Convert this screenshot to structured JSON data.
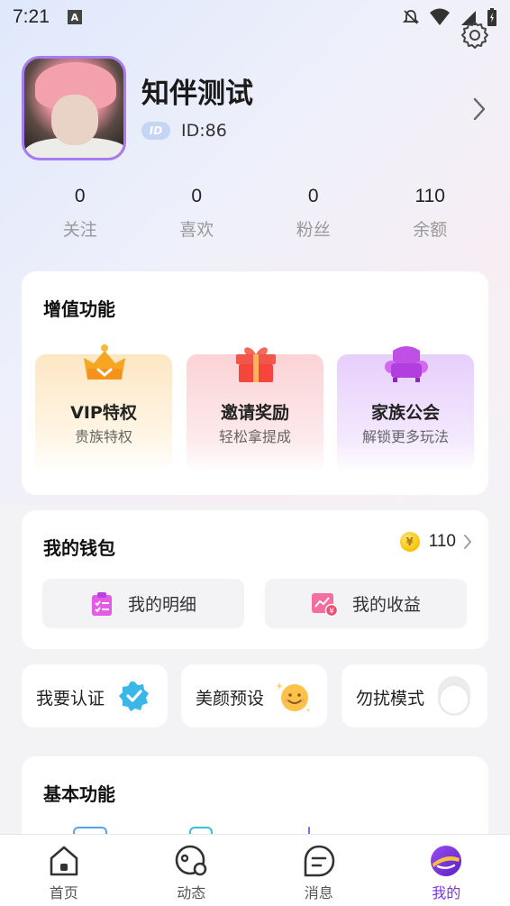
{
  "status_bar": {
    "time": "7:21",
    "a_badge": "A"
  },
  "profile": {
    "nickname": "知伴测试",
    "id_badge": "ID",
    "id_text": "ID:86"
  },
  "stats": [
    {
      "value": "0",
      "label": "关注"
    },
    {
      "value": "0",
      "label": "喜欢"
    },
    {
      "value": "0",
      "label": "粉丝"
    },
    {
      "value": "110",
      "label": "余额"
    }
  ],
  "value_added": {
    "title": "增值功能",
    "tiles": [
      {
        "title": "VIP特权",
        "subtitle": "贵族特权",
        "icon": "crown-icon"
      },
      {
        "title": "邀请奖励",
        "subtitle": "轻松拿提成",
        "icon": "gift-icon"
      },
      {
        "title": "家族公会",
        "subtitle": "解锁更多玩法",
        "icon": "sofa-icon"
      }
    ]
  },
  "wallet": {
    "title": "我的钱包",
    "coin_symbol": "¥",
    "balance": "110",
    "detail_label": "我的明细",
    "income_label": "我的收益"
  },
  "quick": {
    "certify": "我要认证",
    "beauty": "美颜预设",
    "dnd": "勿扰模式",
    "dnd_on": false
  },
  "basic": {
    "title": "基本功能"
  },
  "nav": [
    {
      "label": "首页",
      "icon": "home-icon"
    },
    {
      "label": "动态",
      "icon": "moments-icon"
    },
    {
      "label": "消息",
      "icon": "message-icon"
    },
    {
      "label": "我的",
      "icon": "profile-icon"
    }
  ],
  "colors": {
    "accent": "#7a35e6",
    "avatar_border": "#a77cf0",
    "coin": "#f5c200"
  }
}
